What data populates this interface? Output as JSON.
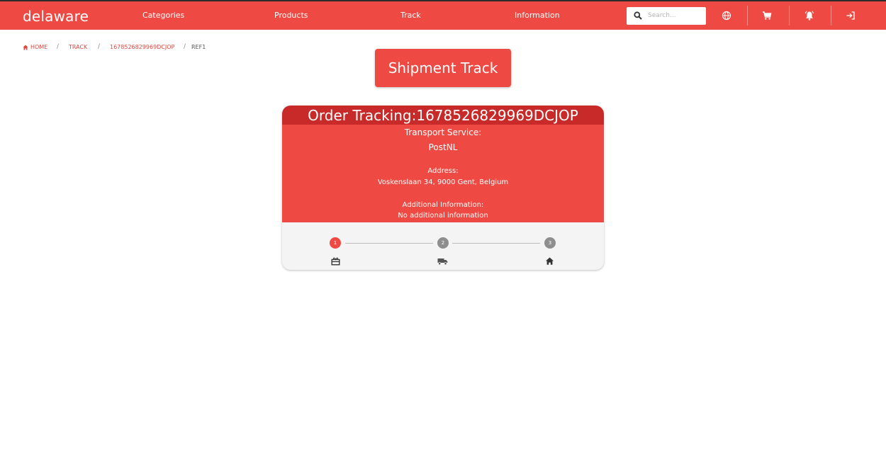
{
  "brand": "delaware",
  "nav": {
    "categories": "Categories",
    "products": "Products",
    "track": "Track",
    "information": "Information"
  },
  "search": {
    "placeholder": "Search..."
  },
  "nav_icons": [
    "search-icon",
    "globe-icon",
    "cart-icon",
    "notification-bell-icon",
    "login-icon"
  ],
  "breadcrumb": {
    "home": "HOME",
    "track": "TRACK",
    "order": "1678526829969DCJOP",
    "current": "REF1",
    "separator": "/"
  },
  "shipment_button": "Shipment Track",
  "order": {
    "title": "Order Tracking:1678526829969DCJOP",
    "transport_label": "Transport Service:",
    "transport_value": "PostNL",
    "address_label": "Address:",
    "address_value": "Voskenslaan 34, 9000 Gent, Belgium",
    "info_label": "Additional Information:",
    "info_value": "No additional information"
  },
  "steps": [
    {
      "number": "1",
      "icon": "package-icon",
      "active": true
    },
    {
      "number": "2",
      "icon": "truck-icon",
      "active": false
    },
    {
      "number": "3",
      "icon": "home-icon",
      "active": false
    }
  ],
  "colors": {
    "accent": "#ee4a43",
    "header_dark": "#c72a28",
    "step_inactive": "#8e8e8e",
    "card_footer": "#f4f4f4"
  }
}
